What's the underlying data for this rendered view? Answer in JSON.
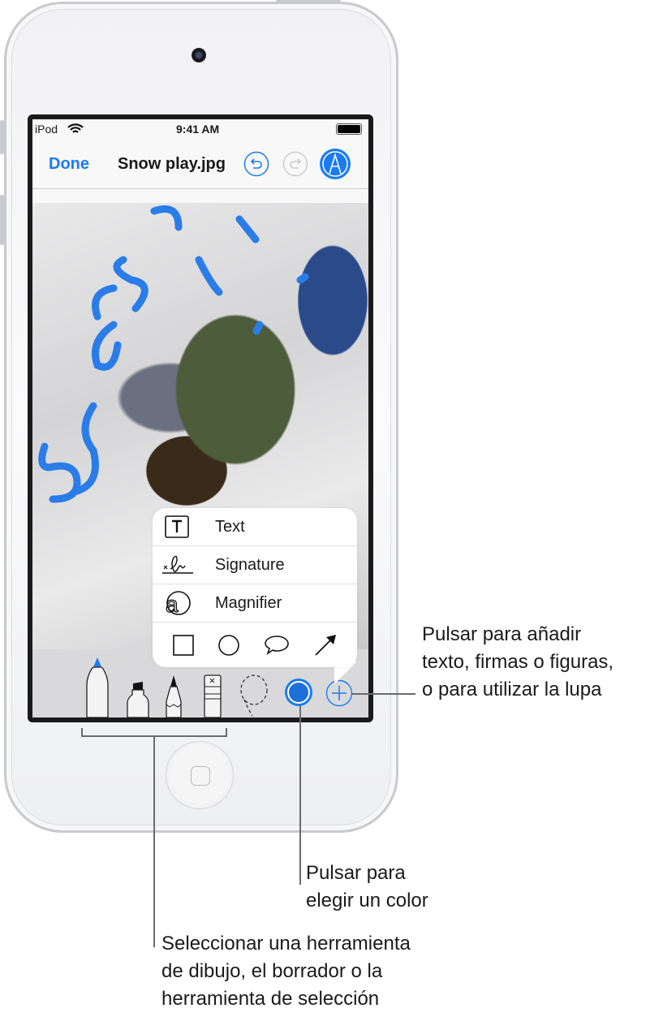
{
  "status_bar": {
    "carrier": "iPod",
    "time": "9:41 AM"
  },
  "nav": {
    "done_label": "Done",
    "title": "Snow play.jpg"
  },
  "popup": {
    "items": [
      {
        "label": "Text",
        "icon": "text-box-icon"
      },
      {
        "label": "Signature",
        "icon": "signature-icon"
      },
      {
        "label": "Magnifier",
        "icon": "magnifier-icon"
      }
    ],
    "shapes": [
      "square-icon",
      "circle-icon",
      "speech-bubble-icon",
      "arrow-icon"
    ]
  },
  "toolbar": {
    "tools": [
      "pen",
      "marker",
      "pencil",
      "eraser",
      "lasso"
    ],
    "selected_color": "#1a7bf0"
  },
  "callouts": {
    "add": [
      "Pulsar para añadir",
      "texto, firmas o figuras,",
      "o para utilizar la lupa"
    ],
    "color": [
      "Pulsar para",
      "elegir un color"
    ],
    "tools": [
      "Seleccionar una herramienta",
      "de dibujo, el borrador o la",
      "herramienta de selección"
    ]
  },
  "colors": {
    "accent": "#1a7bf0",
    "ink": "#2a7de8"
  }
}
